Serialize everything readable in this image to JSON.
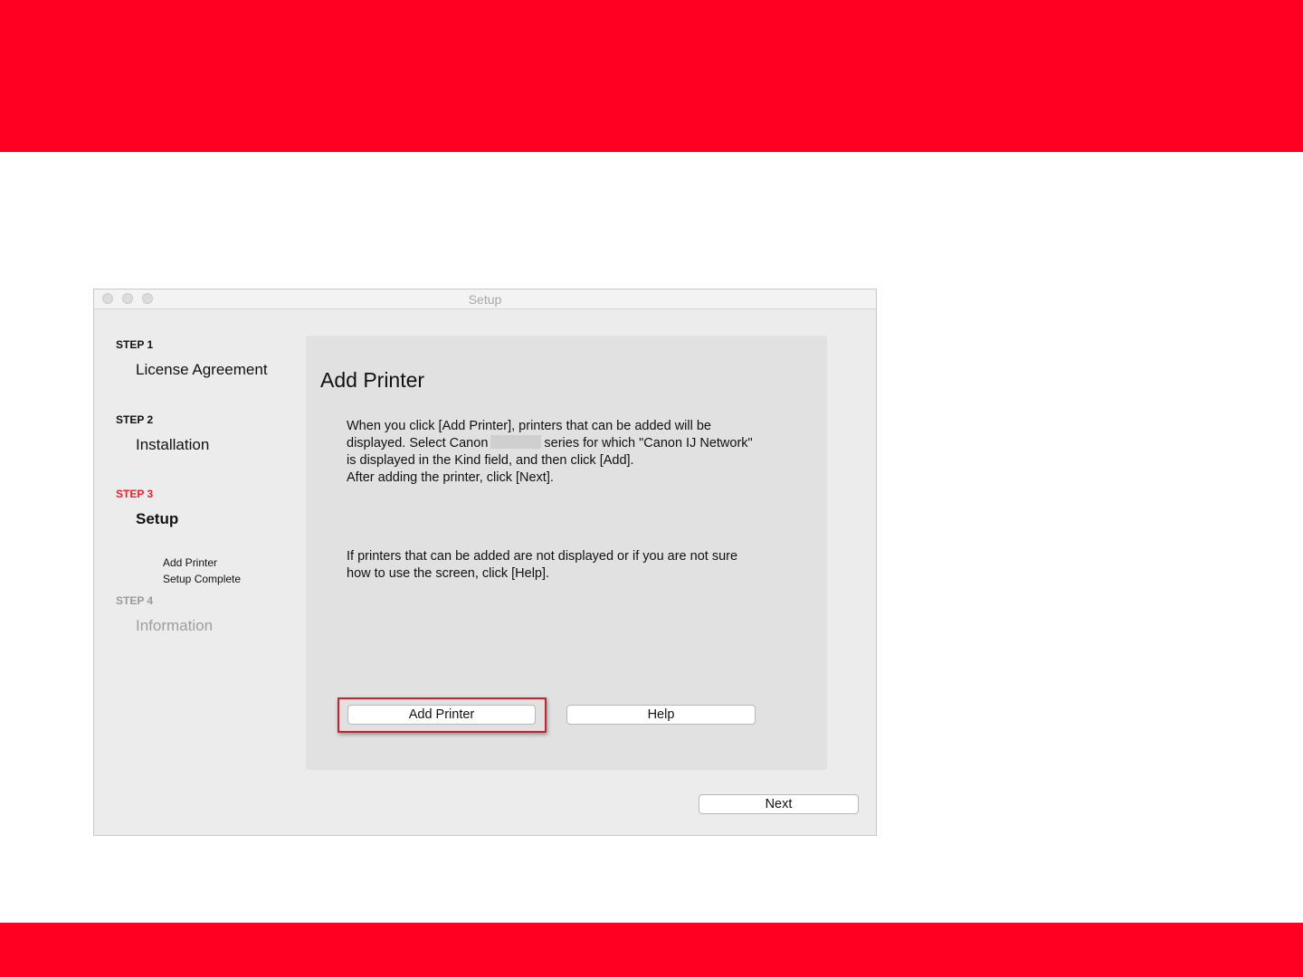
{
  "colors": {
    "brand_red": "#ff0022",
    "step_active": "#f0202a"
  },
  "window": {
    "title": "Setup"
  },
  "steps": [
    {
      "label": "STEP 1",
      "name": "License Agreement"
    },
    {
      "label": "STEP 2",
      "name": "Installation"
    },
    {
      "label": "STEP 3",
      "name": "Setup",
      "sub_items": [
        "Add Printer",
        "Setup Complete"
      ]
    },
    {
      "label": "STEP 4",
      "name": "Information"
    }
  ],
  "panel": {
    "title": "Add Printer",
    "para1_line1": "When you click [Add Printer], printers that can be added will be",
    "para1_line2a": "displayed. Select Canon",
    "para1_line2b": "series for which \"Canon IJ Network\"",
    "para1_line3": "is displayed in the Kind field, and then click [Add].",
    "para1_line4": "After adding the printer, click [Next].",
    "para2_line1": "If printers that can be added are not displayed or if you are not sure",
    "para2_line2": "how to use the screen, click [Help].",
    "add_printer_label": "Add Printer",
    "help_label": "Help"
  },
  "footer": {
    "next_label": "Next"
  }
}
